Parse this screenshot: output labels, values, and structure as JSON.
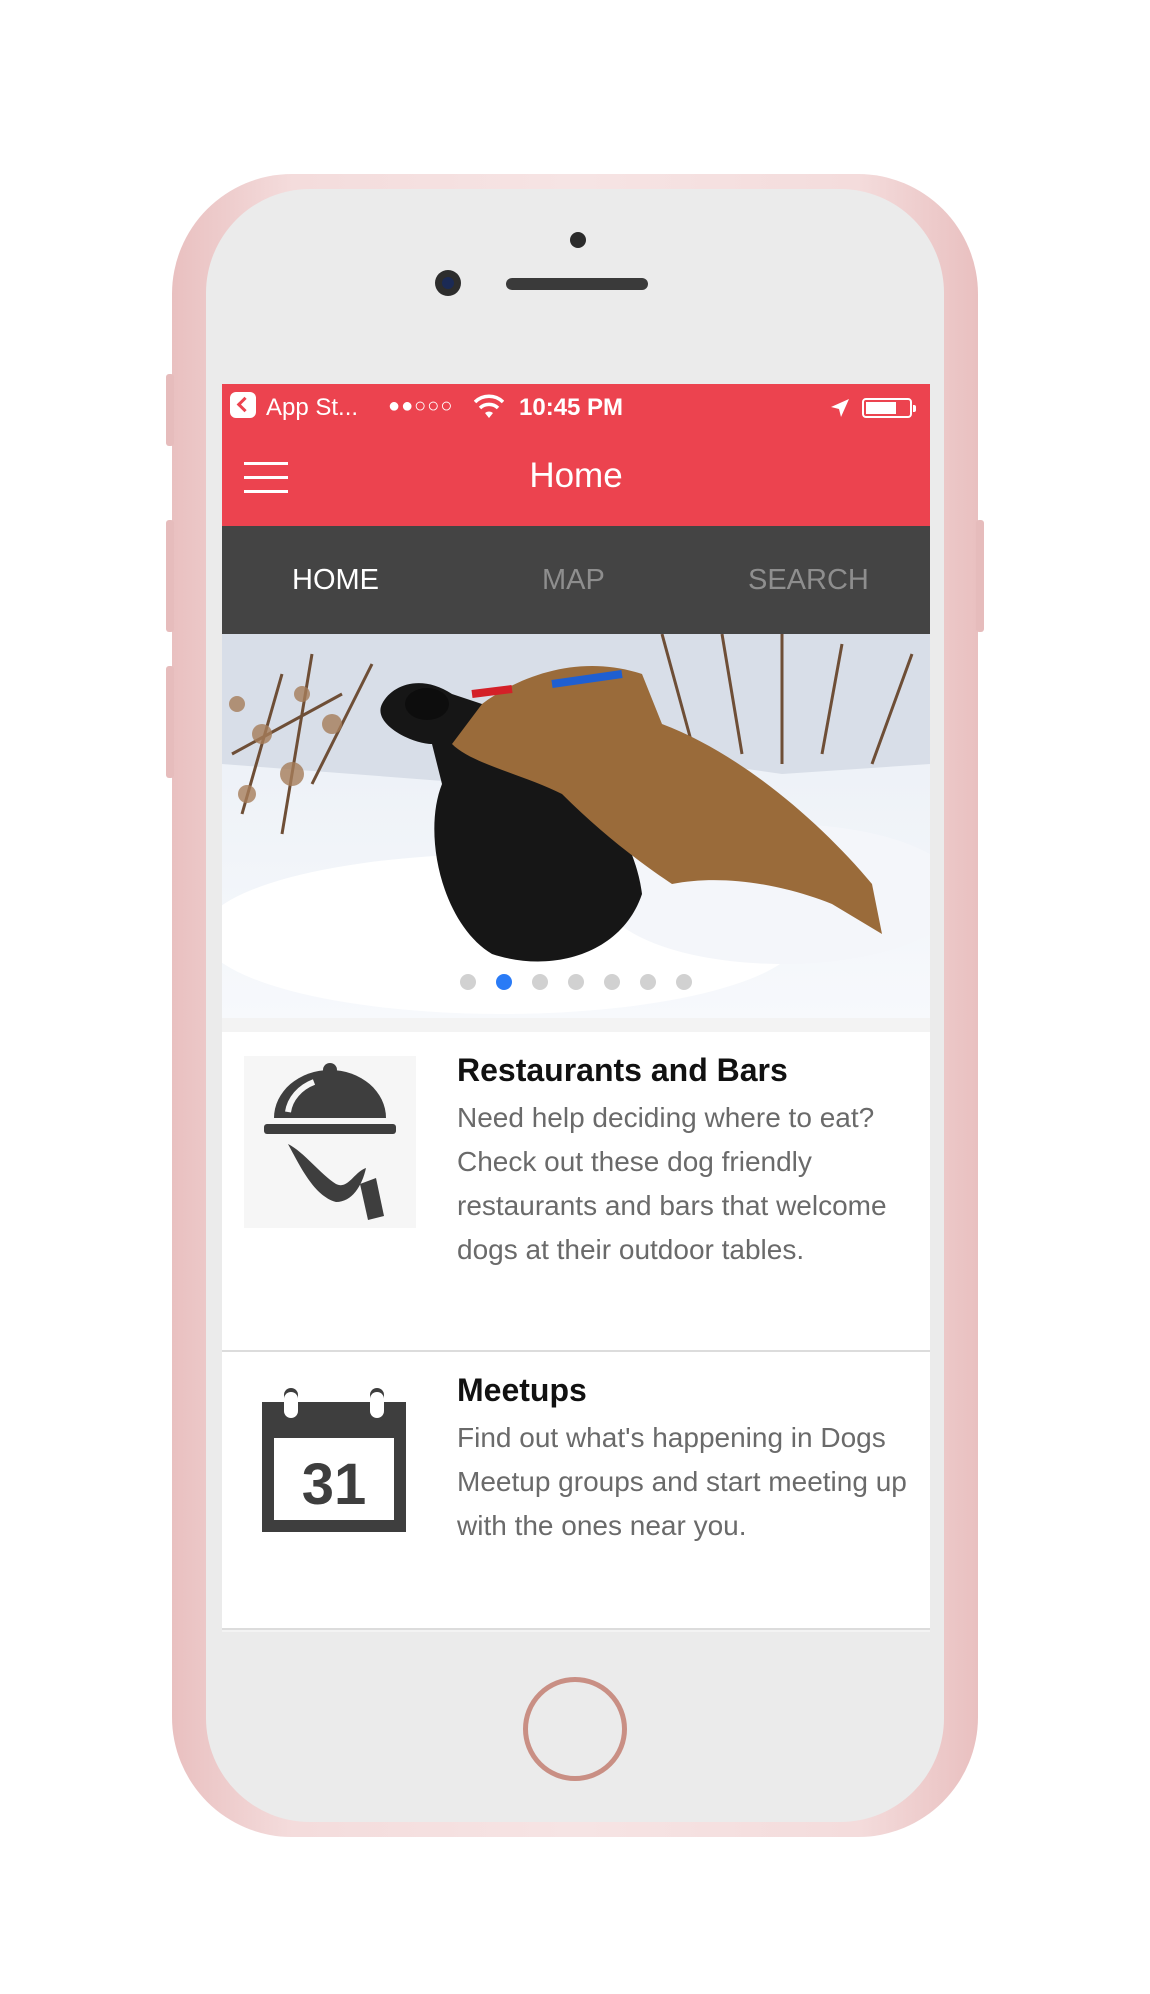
{
  "status_bar": {
    "back_app": "App St...",
    "signal": "●●○○○",
    "time": "10:45 PM"
  },
  "header": {
    "title": "Home"
  },
  "tabs": [
    {
      "label": "HOME",
      "active": true
    },
    {
      "label": "MAP",
      "active": false
    },
    {
      "label": "SEARCH",
      "active": false
    }
  ],
  "carousel": {
    "page_count": 7,
    "current_page": 2
  },
  "cards": [
    {
      "icon": "waiter-cloche-icon",
      "title": "Restaurants and Bars",
      "description": "Need help deciding where to eat? Check out these dog friendly restaurants and bars that welcome dogs at their outdoor tables."
    },
    {
      "icon": "calendar-icon",
      "calendar_day": "31",
      "title": "Meetups",
      "description": "Find out what's happening in Dogs Meetup groups and start meeting up with the ones near you."
    }
  ],
  "colors": {
    "brand_red": "#ec434f",
    "tab_bar": "#444444",
    "active_dot": "#2a7bf6"
  }
}
